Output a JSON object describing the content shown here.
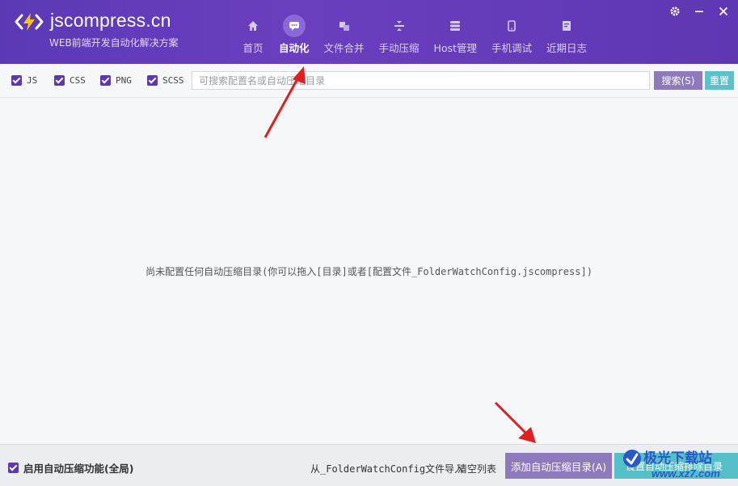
{
  "app": {
    "brand": "jscompress.cn",
    "tagline": "WEB前端开发自动化解决方案"
  },
  "nav": {
    "items": [
      {
        "label": "首页",
        "icon": "home-icon"
      },
      {
        "label": "自动化",
        "icon": "chat-icon",
        "active": true
      },
      {
        "label": "文件合并",
        "icon": "merge-icon"
      },
      {
        "label": "手动压缩",
        "icon": "compress-icon"
      },
      {
        "label": "Host管理",
        "icon": "server-icon"
      },
      {
        "label": "手机调试",
        "icon": "phone-icon"
      },
      {
        "label": "近期日志",
        "icon": "log-icon"
      }
    ]
  },
  "window_controls": [
    "gear-icon",
    "minimize-icon",
    "close-icon"
  ],
  "filters": {
    "items": [
      {
        "label": "JS",
        "checked": true
      },
      {
        "label": "CSS",
        "checked": true
      },
      {
        "label": "PNG",
        "checked": true
      },
      {
        "label": "SCSS",
        "checked": true
      }
    ],
    "search_placeholder": "可搜索配置名或自动压缩目录",
    "search_button": "搜索(S)",
    "reset_button": "重置"
  },
  "main": {
    "empty_message": "尚未配置任何自动压缩目录(你可以拖入[目录]或者[配置文件_FolderWatchConfig.jscompress])"
  },
  "footer": {
    "enable_label": "启用自动压缩功能(全局)",
    "enable_checked": true,
    "import_label": "从_FolderWatchConfig文件导入",
    "clear_label": "清空列表",
    "add_button": "添加自动压缩目录(A)",
    "exclude_button": "设置自动压缩排除目录"
  },
  "watermark": {
    "text": "极光下载站",
    "url": "www.xz7.com"
  },
  "colors": {
    "header": "#5e37b3",
    "accent_purple": "#8f79bd",
    "accent_teal": "#55bfc8",
    "arrow": "#e02020"
  }
}
